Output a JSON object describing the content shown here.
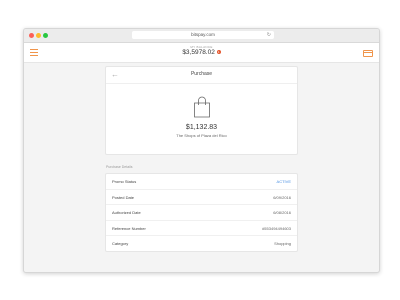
{
  "browser": {
    "url": "bitspay.com"
  },
  "app": {
    "balance_label": "MY BALANCE",
    "balance_amount": "$3,5978.02",
    "balance_badge": "1"
  },
  "purchase": {
    "title": "Purchase",
    "amount": "$1,132.83",
    "merchant": "The Shops of Plaza del Rico"
  },
  "details": {
    "section_label": "Purchase Details",
    "rows": [
      {
        "label": "Promo Status",
        "value": "ACTIVE"
      },
      {
        "label": "Posted Date",
        "value": "6/09/2016"
      },
      {
        "label": "Authorized Date",
        "value": "6/08/2016"
      },
      {
        "label": "Reference Number",
        "value": "#553494494603"
      },
      {
        "label": "Category",
        "value": "Shopping"
      }
    ]
  },
  "colors": {
    "accent": "#f0954b",
    "status_active": "#4a90e2",
    "badge": "#e4572e"
  },
  "icons": [
    "hamburger-menu-icon",
    "credit-card-icon",
    "back-arrow-icon",
    "shopping-bag-icon",
    "reload-icon"
  ]
}
